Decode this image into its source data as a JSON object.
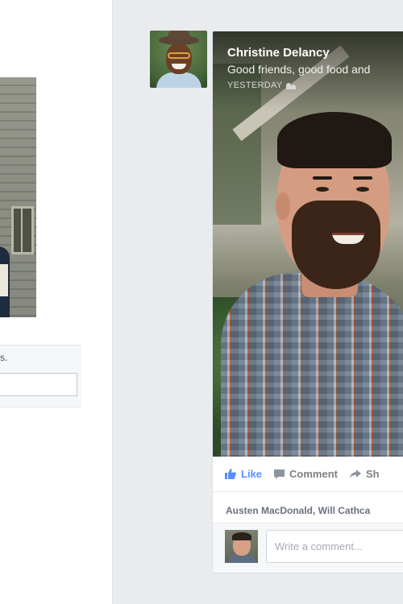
{
  "left_column": {
    "comment_trail": "s."
  },
  "post": {
    "author": "Christine Delancy",
    "text": "Good friends, good food and",
    "timestamp": "YESTERDAY",
    "audience_icon": "friends-icon",
    "actions": {
      "like": "Like",
      "comment": "Comment",
      "share": "Sh"
    },
    "likers": "Austen MacDonald, Will Cathca",
    "comment_placeholder": "Write a comment..."
  },
  "colors": {
    "like_blue": "#5890ff",
    "page_bg": "#e9ebee",
    "action_gray": "#7f7f7f"
  }
}
